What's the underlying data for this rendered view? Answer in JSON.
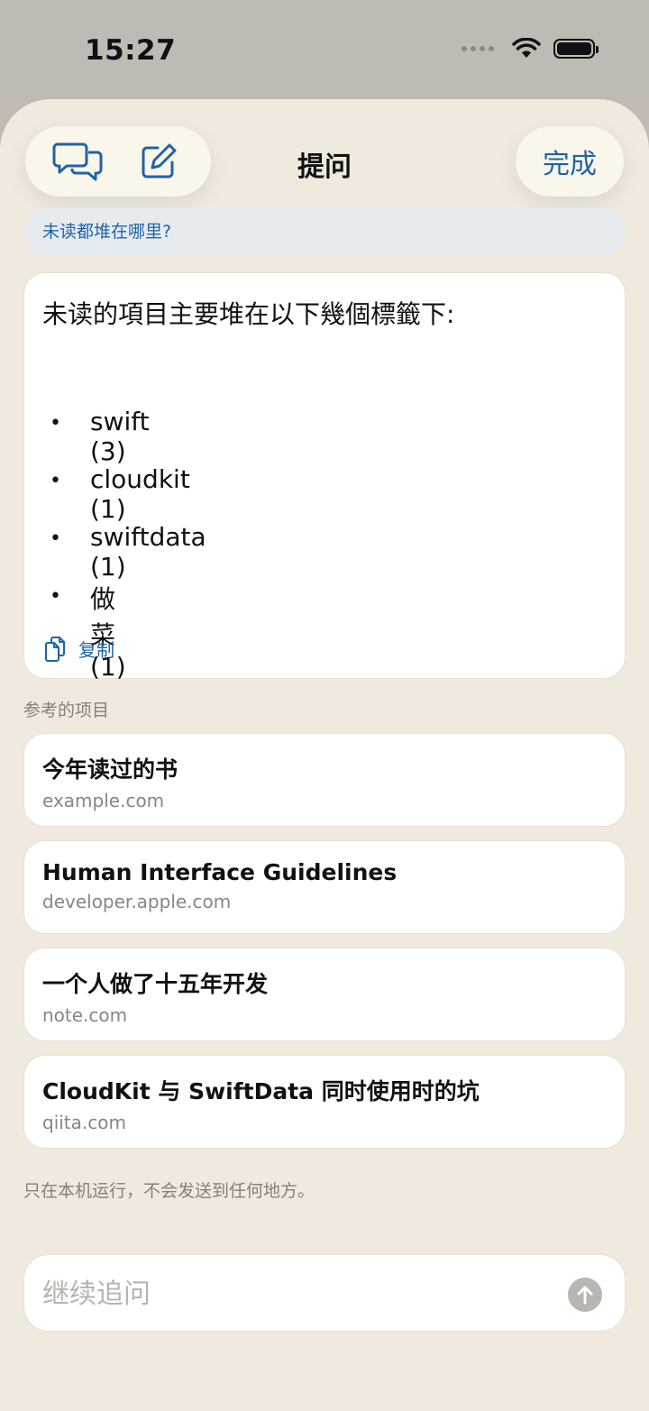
{
  "status_bar": {
    "time": "15:27"
  },
  "header": {
    "title": "提问",
    "done_label": "完成",
    "icons": {
      "chat": "chat-bubbles-icon",
      "compose": "compose-icon"
    }
  },
  "question": "未读都堆在哪里?",
  "answer": {
    "intro": "未读的項目主要堆在以下幾個標籤下:",
    "items": [
      {
        "bullet": "•",
        "text": "swift (3)"
      },
      {
        "bullet": "•",
        "text": "cloudkit (1)"
      },
      {
        "bullet": "•",
        "text": "swiftdata (1)"
      },
      {
        "bullet": "•",
        "text": "做菜 (1)"
      }
    ],
    "copy_label": "复制"
  },
  "references": {
    "label": "参考的项目",
    "items": [
      {
        "title": "今年读过的书",
        "domain": "example.com"
      },
      {
        "title": "Human Interface Guidelines",
        "domain": "developer.apple.com"
      },
      {
        "title": "一个人做了十五年开发",
        "domain": "note.com"
      },
      {
        "title": "CloudKit 与 SwiftData 同时使用时的坑",
        "domain": "qiita.com"
      }
    ]
  },
  "privacy_note": "只在本机运行，不会发送到任何地方。",
  "input": {
    "placeholder": "继续追问",
    "value": ""
  },
  "colors": {
    "accent": "#1f63a8",
    "sheet_bg": "#efe9de",
    "question_bg": "#e6ebf0"
  }
}
